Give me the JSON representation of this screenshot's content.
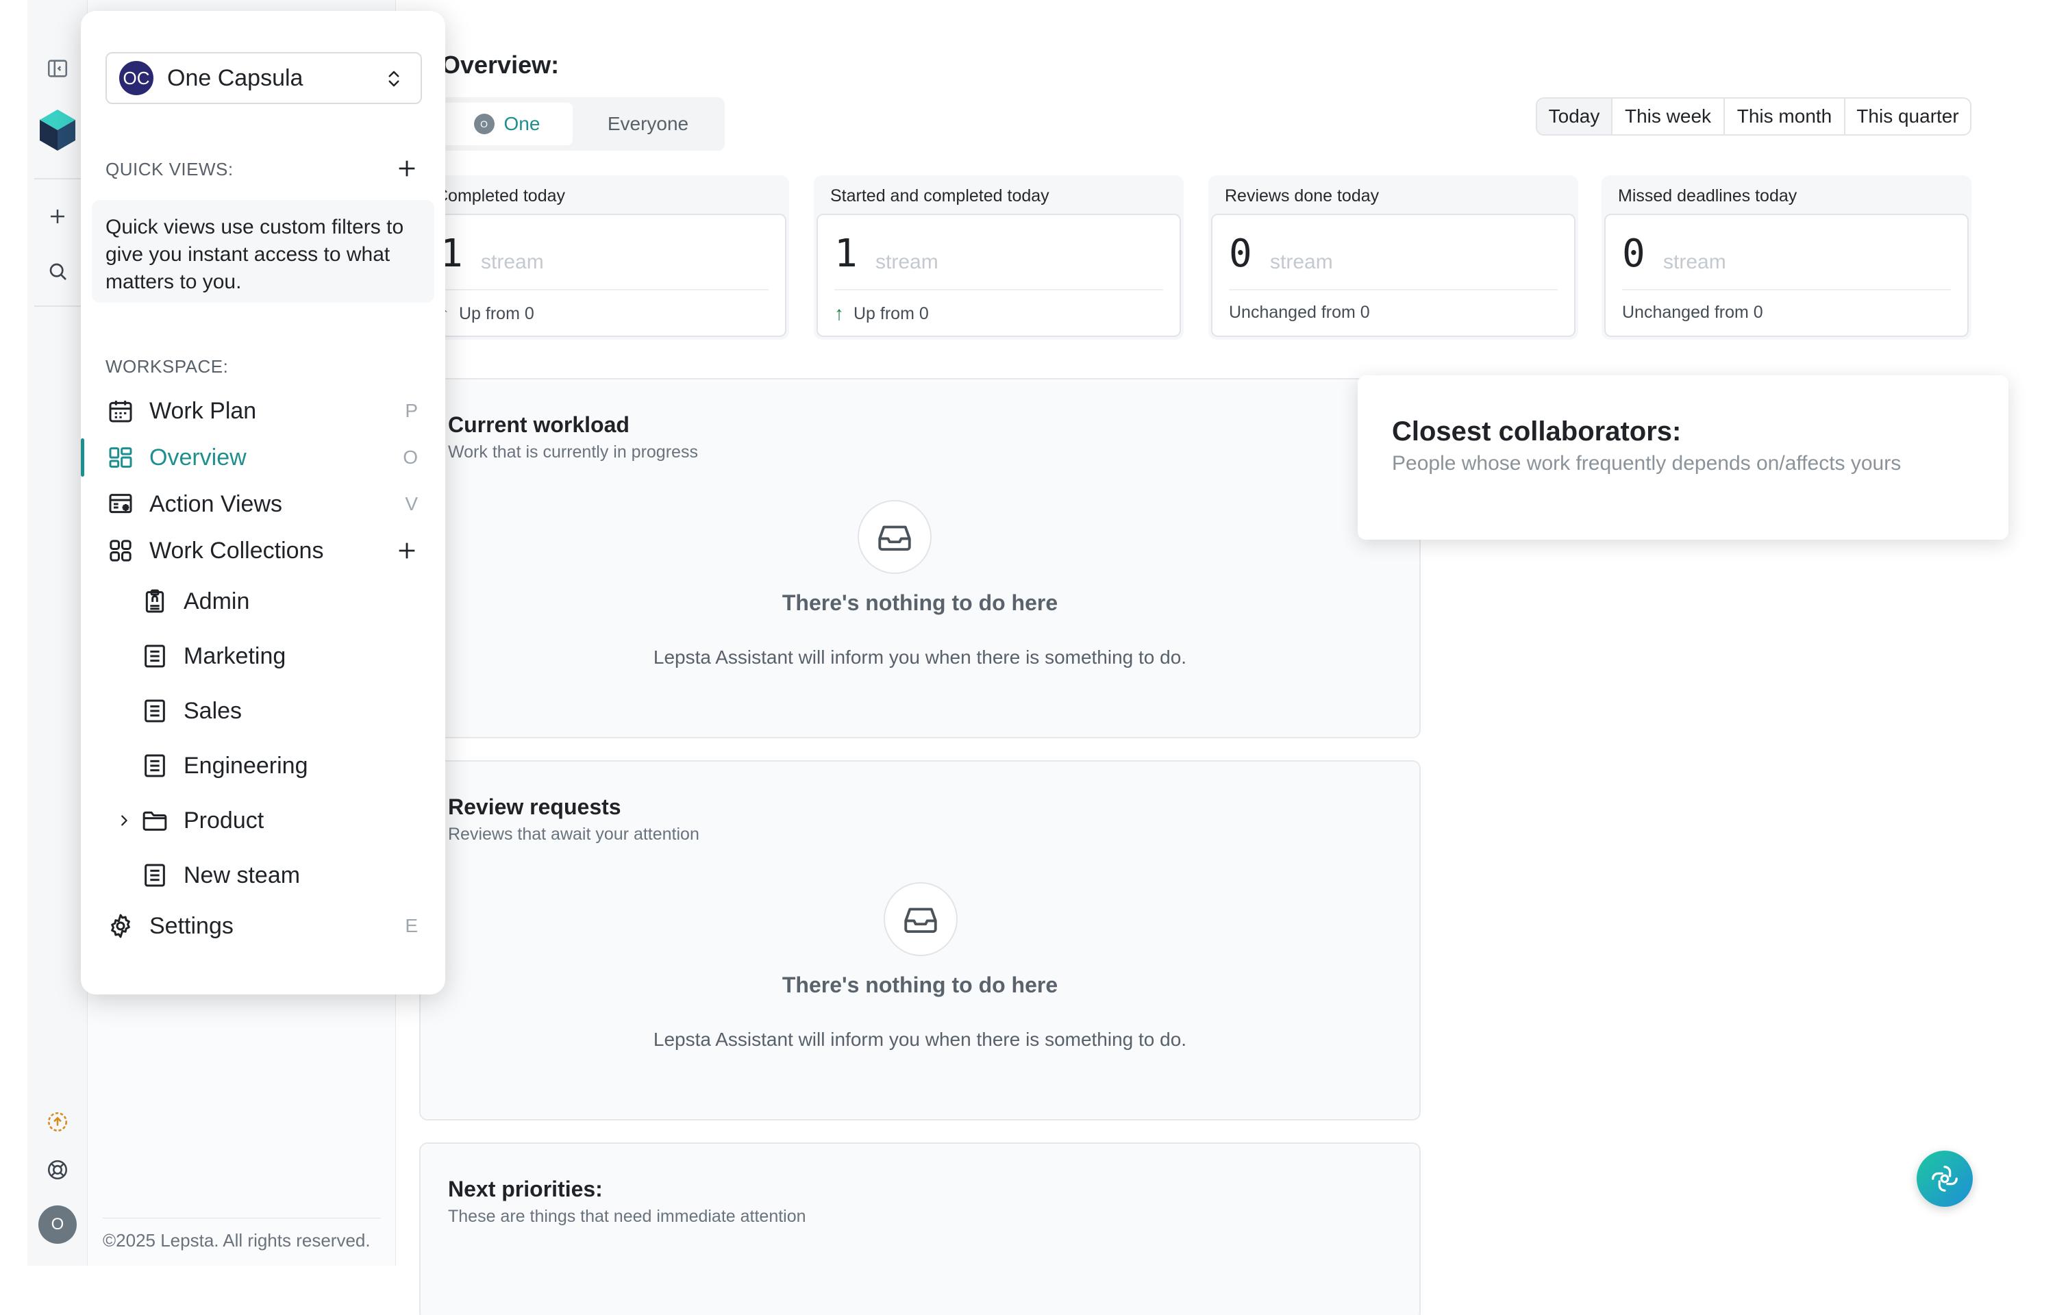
{
  "footer": {
    "copyright": "©2025 Lepsta. All rights reserved."
  },
  "main": {
    "title": "Overview:",
    "scope_tabs": [
      {
        "label": "One",
        "avatar": "O",
        "active": true
      },
      {
        "label": "Everyone",
        "active": false
      }
    ],
    "periods": [
      {
        "label": "Today",
        "active": true
      },
      {
        "label": "This week",
        "active": false
      },
      {
        "label": "This month",
        "active": false
      },
      {
        "label": "This quarter",
        "active": false
      }
    ],
    "stats": [
      {
        "title": "Completed today",
        "value": "1",
        "unit": "stream",
        "change": "Up from 0",
        "trend": "up"
      },
      {
        "title": "Started and completed today",
        "value": "1",
        "unit": "stream",
        "change": "Up from 0",
        "trend": "up"
      },
      {
        "title": "Reviews done today",
        "value": "0",
        "unit": "stream",
        "change": "Unchanged from 0",
        "trend": "flat"
      },
      {
        "title": "Missed deadlines today",
        "value": "0",
        "unit": "stream",
        "change": "Unchanged from 0",
        "trend": "flat"
      }
    ],
    "workload": {
      "title": "Current workload",
      "subtitle": "Work that is currently in progress",
      "empty_title": "There's nothing to do here",
      "empty_text": "Lepsta Assistant will inform you when there is something to do."
    },
    "reviews": {
      "title": "Review requests",
      "subtitle": "Reviews that await your attention",
      "empty_title": "There's nothing to do here",
      "empty_text": "Lepsta Assistant will inform you when there is something to do."
    },
    "priorities": {
      "title": "Next priorities:",
      "subtitle": "These are things that need immediate attention"
    },
    "collaborators": {
      "title": "Closest collaborators:",
      "subtitle": "People whose work frequently depends on/affects yours"
    }
  },
  "rail": {
    "user_initial": "O"
  },
  "popup": {
    "workspace": {
      "initials": "OC",
      "name": "One Capsula"
    },
    "quick_views_label": "QUICK VIEWS:",
    "quick_views_note": "Quick views use custom filters to give you instant access to what matters to you.",
    "workspace_label": "WORKSPACE:",
    "nav": [
      {
        "label": "Work Plan",
        "shortcut": "P",
        "icon": "calendar-icon"
      },
      {
        "label": "Overview",
        "shortcut": "O",
        "icon": "dashboard-icon",
        "active": true
      },
      {
        "label": "Action Views",
        "shortcut": "V",
        "icon": "action-views-icon"
      },
      {
        "label": "Work Collections",
        "icon": "grid-icon"
      }
    ],
    "collections": [
      {
        "label": "Admin",
        "icon": "clipboard-icon"
      },
      {
        "label": "Marketing",
        "icon": "document-icon"
      },
      {
        "label": "Sales",
        "icon": "document-icon"
      },
      {
        "label": "Engineering",
        "icon": "document-icon"
      },
      {
        "label": "Product",
        "icon": "folder-icon",
        "expandable": true
      },
      {
        "label": "New steam",
        "icon": "document-icon"
      }
    ],
    "settings": {
      "label": "Settings",
      "shortcut": "E"
    }
  },
  "colors": {
    "accent": "#1e8f8f",
    "positive": "#1a7f37"
  }
}
